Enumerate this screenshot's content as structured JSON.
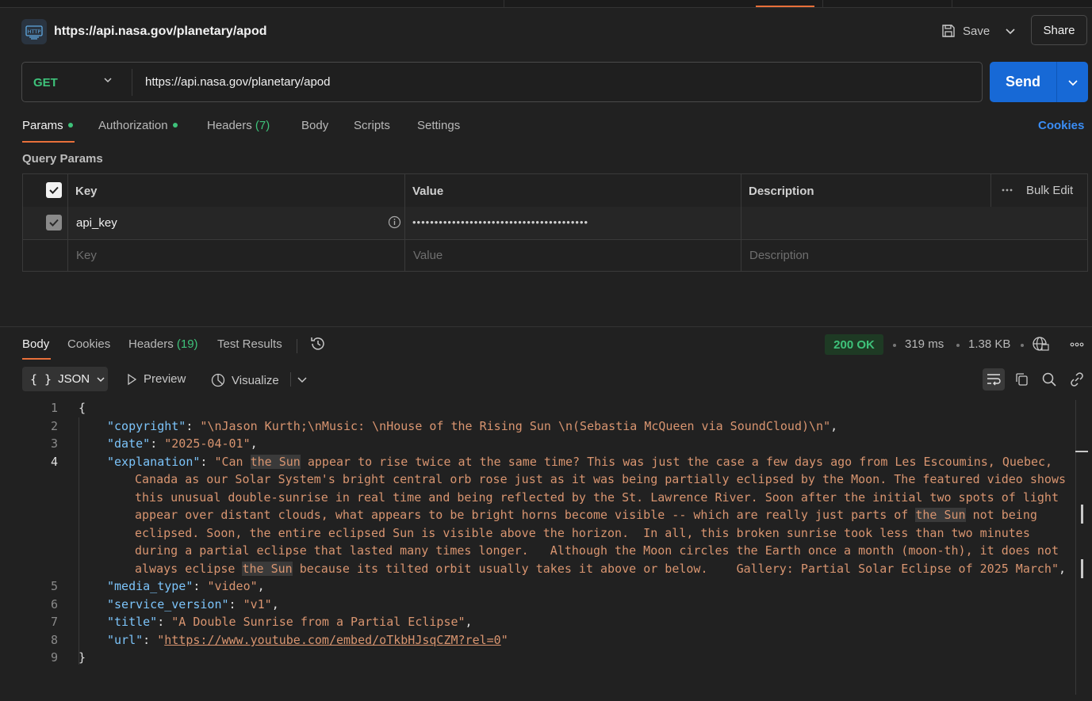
{
  "request": {
    "icon": "http-icon",
    "icon_text": "HTTP",
    "title": "https://api.nasa.gov/planetary/apod",
    "save_label": "Save",
    "share_label": "Share",
    "method": "GET",
    "url": "https://api.nasa.gov/planetary/apod",
    "send_label": "Send"
  },
  "request_tabs": {
    "params": "Params",
    "authorization": "Authorization",
    "headers": "Headers",
    "headers_count": "(7)",
    "body": "Body",
    "scripts": "Scripts",
    "settings": "Settings",
    "cookies": "Cookies"
  },
  "query_params": {
    "label": "Query Params",
    "headers": {
      "key": "Key",
      "value": "Value",
      "description": "Description",
      "bulk_edit": "Bulk Edit"
    },
    "rows": [
      {
        "key": "api_key",
        "value": "••••••••••••••••••••••••••••••••••••••••",
        "description": "",
        "checked": true
      }
    ],
    "placeholders": {
      "key": "Key",
      "value": "Value",
      "description": "Description"
    }
  },
  "response_tabs": {
    "body": "Body",
    "cookies": "Cookies",
    "headers": "Headers",
    "headers_count": "(19)",
    "test_results": "Test Results"
  },
  "response_meta": {
    "status": "200 OK",
    "time": "319 ms",
    "size": "1.38 KB"
  },
  "format_bar": {
    "format_icon": "{ }",
    "format": "JSON",
    "preview": "Preview",
    "visualize": "Visualize"
  },
  "response_body": {
    "line_numbers": [
      "1",
      "2",
      "3",
      "4",
      "5",
      "6",
      "7",
      "8",
      "9"
    ],
    "open_brace": "{",
    "close_brace": "}",
    "fields": {
      "copyright_key": "\"copyright\"",
      "copyright_val": "\"\\nJason Kurth;\\nMusic: \\nHouse of the Rising Sun \\n(Sebastia McQueen via SoundCloud)\\n\"",
      "date_key": "\"date\"",
      "date_val": "\"2025-04-01\"",
      "explanation_key": "\"explanation\"",
      "explanation_lines": [
        "\"Can the Sun appear to rise twice at the same time? This was just the case a few days ago from Les Escoumins, Quebec,",
        "Canada as our Solar System's bright central orb rose just as it was being partially eclipsed by the Moon. The featured video shows",
        "this unusual double-sunrise in real time and being reflected by the St. Lawrence River. Soon after the initial two spots of light",
        "appear over distant clouds, what appears to be bright horns become visible -- which are really just parts of the Sun not being",
        "eclipsed. Soon, the entire eclipsed Sun is visible above the horizon.  In all, this broken sunrise took less than two minutes",
        "during a partial eclipse that lasted many times longer.   Although the Moon circles the Earth once a month (moon-th), it does not",
        "always eclipse the Sun because its tilted orbit usually takes it above or below.    Gallery: Partial Solar Eclipse of 2025 March\""
      ],
      "media_type_key": "\"media_type\"",
      "media_type_val": "\"video\"",
      "service_version_key": "\"service_version\"",
      "service_version_val": "\"v1\"",
      "title_key": "\"title\"",
      "title_val": "\"A Double Sunrise from a Partial Eclipse\"",
      "url_key": "\"url\"",
      "url_val": "https://www.youtube.com/embed/oTkbHJsqCZM?rel=0"
    }
  },
  "colors": {
    "accent_orange": "#e8703a",
    "send_blue": "#1769d6",
    "status_green": "#3ec27a",
    "json_key": "#7cc4fa",
    "json_string": "#d99570"
  }
}
